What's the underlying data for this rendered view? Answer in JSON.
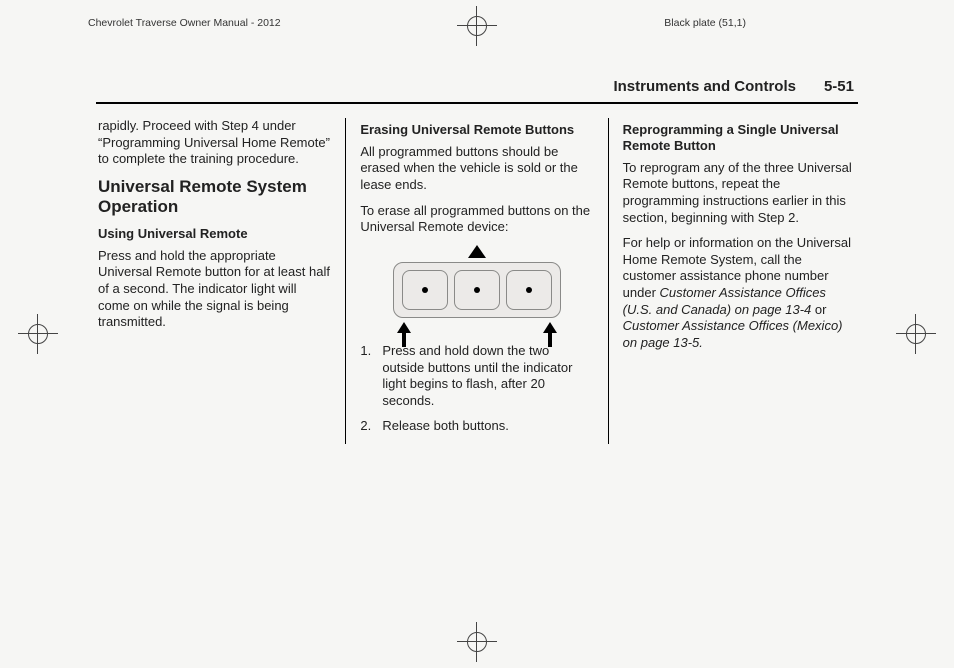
{
  "header": {
    "left": "Chevrolet Traverse Owner Manual - 2012",
    "right": "Black plate (51,1)"
  },
  "running_head": {
    "section": "Instruments and Controls",
    "page": "5-51"
  },
  "col1": {
    "lead": "rapidly. Proceed with Step 4 under “Programming Universal Home Remote” to complete the training procedure.",
    "h2": "Universal Remote System Operation",
    "h3": "Using Universal Remote",
    "p1": "Press and hold the appropriate Universal Remote button for at least half of a second. The indicator light will come on while the signal is being transmitted."
  },
  "col2": {
    "h3": "Erasing Universal Remote Buttons",
    "p1": "All programmed buttons should be erased when the vehicle is sold or the lease ends.",
    "p2": "To erase all programmed buttons on the Universal Remote device:",
    "steps": [
      "Press and hold down the two outside buttons until the indicator light begins to flash, after 20 seconds.",
      "Release both buttons."
    ],
    "illustration_label": "universal-remote-device"
  },
  "col3": {
    "h3": "Reprogramming a Single Universal Remote Button",
    "p1": "To reprogram any of the three Universal Remote buttons, repeat the programming instructions earlier in this section, beginning with Step 2.",
    "p2a": "For help or information on the Universal Home Remote System, call the customer assistance phone number under ",
    "ref1": "Customer Assistance Offices (U.S. and Canada) on page 13‑4",
    "mid": " or ",
    "ref2": "Customer Assistance Offices (Mexico) on page 13‑5.",
    "tail": ""
  }
}
